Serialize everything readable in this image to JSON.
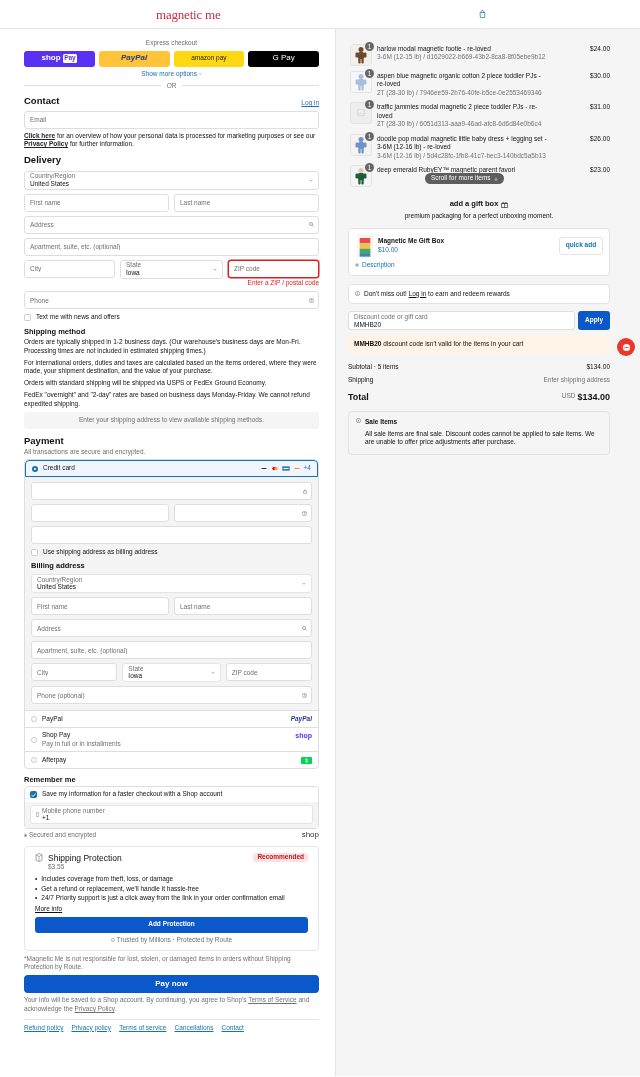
{
  "header": {
    "logo": "magnetic me"
  },
  "express": {
    "label": "Express checkout",
    "buttons": [
      {
        "kind": "shop_pay",
        "label": "shop",
        "badge": "Pay"
      },
      {
        "kind": "paypal",
        "label": "PayPal"
      },
      {
        "kind": "amazon_pay",
        "label": "amazon pay"
      },
      {
        "kind": "google_pay",
        "label": "G Pay"
      }
    ],
    "more": "Show more options",
    "divider": "OR"
  },
  "contact": {
    "title": "Contact",
    "login": "Log in",
    "email": {
      "kind": "text",
      "placeholder": "Email"
    },
    "notice": [
      {
        "kind": "link",
        "text": "Click here"
      },
      {
        "kind": "text",
        "text": " for an overview of how your personal data is processed for marketing purposes or see our "
      },
      {
        "kind": "link",
        "text": "Privacy Policy"
      },
      {
        "kind": "text",
        "text": " for further information."
      }
    ]
  },
  "delivery": {
    "title": "Delivery",
    "rows": [
      [
        {
          "kind": "select",
          "label": "Country/Region",
          "value": "United States"
        }
      ],
      [
        {
          "kind": "text",
          "placeholder": "First name"
        },
        {
          "kind": "text",
          "placeholder": "Last name"
        }
      ],
      [
        {
          "kind": "search",
          "placeholder": "Address"
        }
      ],
      [
        {
          "kind": "text",
          "placeholder": "Apartment, suite, etc. (optional)"
        }
      ],
      [
        {
          "kind": "text",
          "placeholder": "City"
        },
        {
          "kind": "select",
          "label": "State",
          "value": "Iowa"
        },
        {
          "kind": "text",
          "placeholder": "ZIP code",
          "invalid": true,
          "error": "Enter a ZIP / postal code"
        }
      ],
      [
        {
          "kind": "help",
          "placeholder": "Phone"
        }
      ]
    ],
    "sms": {
      "label": "Text me with news and offers",
      "checked": false
    }
  },
  "shipping": {
    "title": "Shipping method",
    "paragraphs": [
      "Orders are typically shipped in 1-2 business days. (Our warehouse's business days are Mon-Fri. Processing times are not included in estimated shipping times.)",
      "For international orders, duties and taxes are calculated based on the items ordered, where they were made, your shipment destination, and the value of your purchase.",
      "Orders with standard shipping will be shipped via USPS or FedEx Ground Economy.",
      "FedEx \"overnight\" and \"2-day\" rates are based on business days Monday-Friday. We cannot refund expedited shipping."
    ],
    "notice": "Enter your shipping address to view available shipping methods."
  },
  "payment": {
    "title": "Payment",
    "subtitle": "All transactions are secure and encrypted.",
    "methods": [
      {
        "kind": "card",
        "label": "Credit card",
        "selected": true,
        "more_brands": "+4",
        "card_rows": [
          [
            {
              "kind": "lock"
            }
          ],
          [
            {
              "kind": "text"
            },
            {
              "kind": "help"
            }
          ],
          [
            {
              "kind": "text"
            }
          ]
        ],
        "billing_same": {
          "label": "Use shipping address as billing address",
          "checked": false
        },
        "billing": {
          "title": "Billing address",
          "rows": [
            [
              {
                "kind": "select",
                "label": "Country/Region",
                "value": "United States"
              }
            ],
            [
              {
                "kind": "text",
                "placeholder": "First name"
              },
              {
                "kind": "text",
                "placeholder": "Last name"
              }
            ],
            [
              {
                "kind": "search",
                "placeholder": "Address"
              }
            ],
            [
              {
                "kind": "text",
                "placeholder": "Apartment, suite, etc. (optional)"
              }
            ],
            [
              {
                "kind": "text",
                "placeholder": "City"
              },
              {
                "kind": "select",
                "label": "State",
                "value": "Iowa"
              },
              {
                "kind": "text",
                "placeholder": "ZIP code"
              }
            ],
            [
              {
                "kind": "help",
                "placeholder": "Phone (optional)"
              }
            ]
          ]
        }
      },
      {
        "kind": "paypal",
        "label": "PayPal",
        "selected": false,
        "logo": "PayPal"
      },
      {
        "kind": "shop_pay",
        "label": "Shop Pay",
        "selected": false,
        "sub": "Pay in full or in installments",
        "logo": "shop"
      },
      {
        "kind": "afterpay",
        "label": "Afterpay",
        "selected": false
      }
    ]
  },
  "remember": {
    "title": "Remember me",
    "save": {
      "label": "Save my information for a faster checkout with a Shop account",
      "checked": true
    },
    "phone": {
      "kind": "phone",
      "label": "Mobile phone number",
      "value": "+1"
    },
    "secure": "Secured and encrypted",
    "shop": "shop"
  },
  "protection": {
    "title": "Shipping Protection",
    "price": "$3.55",
    "badge": "Recommended",
    "bullet": "•",
    "bullets": [
      "Includes coverage from theft, loss, or damage",
      "Get a refund or replacement, we'll handle it hassle-free",
      "24/7 Priority support is just a click away from the link in your order confirmation email"
    ],
    "more": "More info",
    "button": "Add Protection",
    "trust": "Trusted by Millions · Protected by Route"
  },
  "disclaimer": "*Magnetic Me is not responsible for lost, stolen, or damaged items in orders without Shipping Protection by Route.",
  "pay_button": "Pay now",
  "consent": [
    {
      "kind": "text",
      "text": "Your info will be saved to a Shop account. By continuing, you agree to Shop's "
    },
    {
      "kind": "link",
      "text": "Terms of Service"
    },
    {
      "kind": "text",
      "text": " and acknowledge the "
    },
    {
      "kind": "link",
      "text": "Privacy Policy"
    },
    {
      "kind": "text",
      "text": "."
    }
  ],
  "footer_links": [
    "Refund policy",
    "Privacy policy",
    "Terms of service",
    "Cancellations",
    "Contact"
  ],
  "cart": {
    "items": [
      {
        "qty": "1",
        "title": "harlow modal magnetic footie - re-loved",
        "variant": "3-6M (12-15 lb) / d1629022-b669-43b2-8ca8-8f05ebe9b12",
        "price": "$24.00"
      },
      {
        "qty": "1",
        "title": "aspen blue magnetic organic cotton 2 piece toddler PJs - re-loved",
        "variant": "2T (28-30 lb) / 7946ee59-2b76-40fe-b5ce-0e2553469346",
        "price": "$30.00"
      },
      {
        "thumb": {
          "kind": "placeholder"
        },
        "qty": "1",
        "title": "traffic jammies modal magnetic 2 piece toddler PJs - re-loved",
        "variant": "2T (28-30 lb) / 6051d313-aaa9-46ad-afc8-6d6d84e0b6c4",
        "price": "$31.00"
      },
      {
        "qty": "1",
        "title": "doodle pop modal magnetic little baby dress + legging set - 3-6M (12-16 lb) - re-loved",
        "variant": "3-6M (12-16 lb) / 5d4c28fc-1fb8-41c7-bec3-140bdc5a5b13",
        "price": "$26.00"
      },
      {
        "qty": "1",
        "title": "deep emerald RubyEY™ magnetic parent favori",
        "price": "$23.00"
      }
    ],
    "scroll_hint": "Scroll for more items"
  },
  "gift": {
    "title": "add a gift box",
    "subtitle": "premium packaging for a perfect unboxing moment.",
    "name": "Magnetic Me Gift Box",
    "price": "$10.00",
    "button": "quick add",
    "description": "Description"
  },
  "rewards": [
    {
      "kind": "text",
      "text": "Don't miss out! "
    },
    {
      "kind": "link",
      "text": "Log in"
    },
    {
      "kind": "text",
      "text": " to earn and redeem rewards"
    }
  ],
  "discount": {
    "label": "Discount code or gift card",
    "value": "MMHB20",
    "button": "Apply",
    "warning": "**MMHB20** discount code isn't valid for the items in your cart"
  },
  "summary": {
    "subtotal_label": "Subtotal · 5 items",
    "subtotal": "$134.00",
    "shipping_label": "Shipping",
    "shipping": "Enter shipping address",
    "total_label": "Total",
    "currency": "USD",
    "total": "$134.00"
  },
  "sale": {
    "title": "Sale Items",
    "text": "All sale items are final sale. Discount codes cannot be applied to sale items. We are unable to offer price adjustments after purchase."
  }
}
